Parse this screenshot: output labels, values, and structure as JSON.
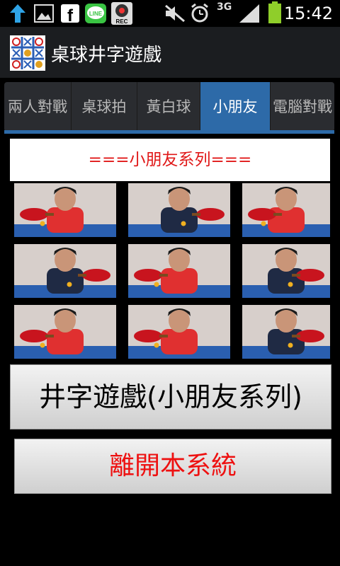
{
  "status_bar": {
    "time": "15:42",
    "network_label": "3G",
    "rec_label": "REC",
    "line_label": "LINE",
    "icons": [
      "upload-arrow-icon",
      "gallery-icon",
      "facebook-icon",
      "line-app-icon",
      "record-icon",
      "mute-icon",
      "alarm-icon",
      "signal-icon",
      "battery-icon"
    ]
  },
  "app_bar": {
    "title": "桌球井字遊戲"
  },
  "tabs": [
    {
      "label": "兩人對戰",
      "active": false
    },
    {
      "label": "桌球拍",
      "active": false
    },
    {
      "label": "黃白球",
      "active": false
    },
    {
      "label": "小朋友",
      "active": true
    },
    {
      "label": "電腦對戰",
      "active": false
    }
  ],
  "section": {
    "title": "===小朋友系列==="
  },
  "photos": {
    "count": 9,
    "subject": "child-table-tennis-photo"
  },
  "buttons": {
    "start_game": "井字遊戲(小朋友系列)",
    "exit": "離開本系統"
  },
  "colors": {
    "accent": "#2d6aa8",
    "exit_text": "#ee1111",
    "section_title": "#e01818"
  }
}
